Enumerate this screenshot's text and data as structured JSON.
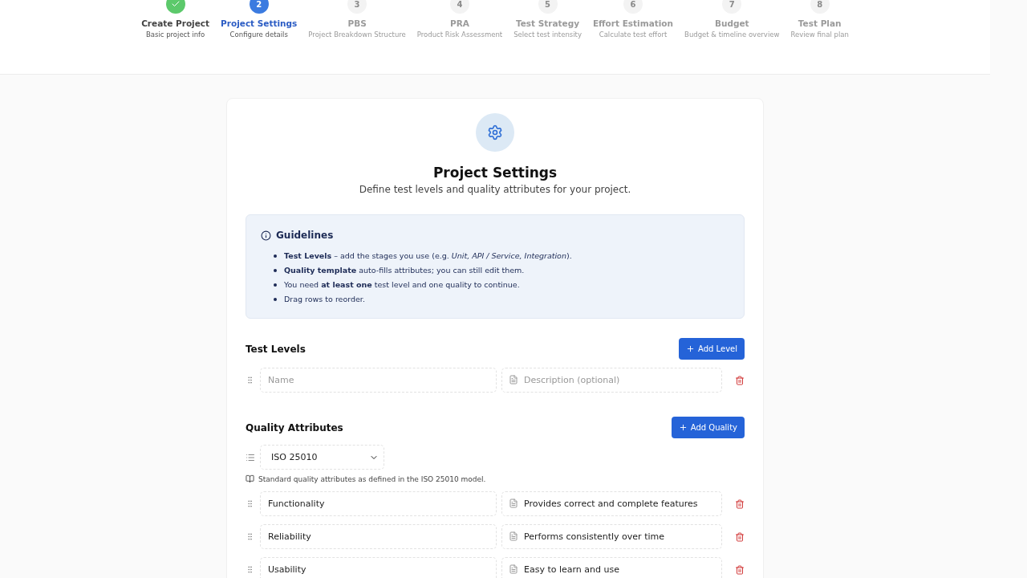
{
  "steps": [
    {
      "title": "Create Project",
      "subtitle": "Basic project info",
      "completed": true,
      "selected": false
    },
    {
      "number": "2",
      "title": "Project Settings",
      "subtitle": "Configure details",
      "completed": false,
      "selected": true
    },
    {
      "number": "3",
      "title": "PBS",
      "subtitle": "Project Breakdown Structure",
      "completed": false,
      "selected": false
    },
    {
      "number": "4",
      "title": "PRA",
      "subtitle": "Product Risk Assessment",
      "completed": false,
      "selected": false
    },
    {
      "number": "5",
      "title": "Test Strategy",
      "subtitle": "Select test intensity",
      "completed": false,
      "selected": false
    },
    {
      "number": "6",
      "title": "Effort Estimation",
      "subtitle": "Calculate test effort",
      "completed": false,
      "selected": false
    },
    {
      "number": "7",
      "title": "Budget",
      "subtitle": "Budget & timeline overview",
      "completed": false,
      "selected": false
    },
    {
      "number": "8",
      "title": "Test Plan",
      "subtitle": "Review final plan",
      "completed": false,
      "selected": false
    }
  ],
  "page": {
    "title": "Project Settings",
    "subtitle": "Define test levels and quality attributes for your project."
  },
  "guidelines": {
    "title": "Guidelines",
    "items": [
      "**Test Levels** – add the stages you use (e.g. *Unit, API / Service, Integration*).",
      "**Quality template** auto-fills attributes; you can still edit them.",
      "You need **at least one** test level and one quality to continue.",
      "Drag rows to reorder."
    ]
  },
  "test_levels": {
    "heading": "Test Levels",
    "add_button": "Add Level",
    "rows": [
      {
        "name": {
          "placeholder": "Name"
        },
        "description": {
          "placeholder": "Description (optional)"
        }
      }
    ]
  },
  "quality_attributes": {
    "heading": "Quality Attributes",
    "add_button": "Add Quality",
    "template": {
      "value": "ISO 25010"
    },
    "note": "Standard quality attributes as defined in the ISO 25010 model.",
    "rows": [
      {
        "name": {
          "value": "Functionality"
        },
        "description": {
          "value": "Provides correct and complete features"
        }
      },
      {
        "name": {
          "value": "Reliability"
        },
        "description": {
          "value": "Performs consistently over time"
        }
      },
      {
        "name": {
          "value": "Usability"
        },
        "description": {
          "value": "Easy to learn and use"
        }
      }
    ]
  }
}
